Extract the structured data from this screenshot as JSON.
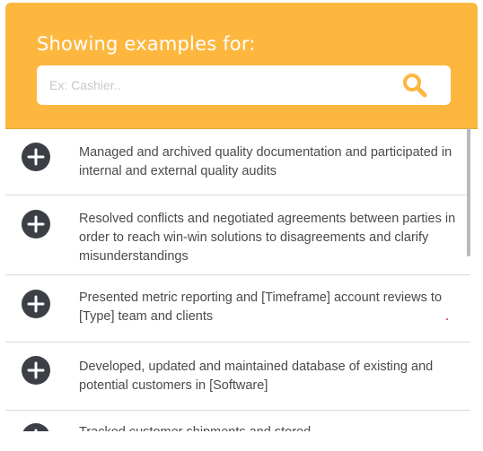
{
  "header": {
    "title": "Showing examples for:",
    "search_placeholder": "Ex: Cashier..",
    "accent_color": "#fdb73f",
    "search_icon": "search-icon"
  },
  "examples": [
    {
      "text": "Managed and archived quality documentation and participated in internal and external quality audits",
      "icon": "plus-circle-icon"
    },
    {
      "text": "Resolved conflicts and negotiated agreements between parties in order to reach win-win solutions to disagreements and clarify misunderstandings",
      "icon": "plus-circle-icon"
    },
    {
      "text": "Presented metric reporting and [Timeframe] account reviews to [Type] team and clients",
      "icon": "plus-circle-icon"
    },
    {
      "text": "Developed, updated and maintained database of existing and potential customers in [Software]",
      "icon": "plus-circle-icon"
    },
    {
      "text": "Tracked customer shipments and stored...",
      "icon": "plus-circle-icon"
    }
  ]
}
